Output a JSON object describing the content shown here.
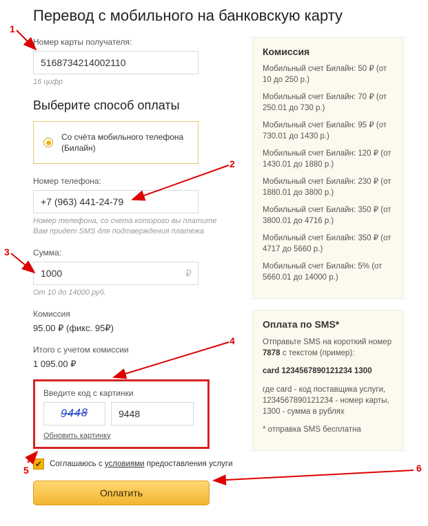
{
  "title": "Перевод с мобильного на банковскую карту",
  "card": {
    "label": "Номер карты получателя:",
    "value": "5168734214002110",
    "hint": "16 цифр"
  },
  "method_heading": "Выберите способ оплаты",
  "method_radio": "Со счёта мобильного телефона (Билайн)",
  "phone": {
    "label": "Номер телефона:",
    "value": "+7 (963) 441-24-79",
    "hint": "Номер телефона, со счета которого вы платите\nВам придет SMS для подтверждения платежа"
  },
  "amount": {
    "label": "Сумма:",
    "value": "1000",
    "suffix": "₽",
    "hint": "От 10 до 14000 руб."
  },
  "fee": {
    "label": "Комиссия",
    "value": "95.00 ₽ (фикс. 95₽)"
  },
  "total": {
    "label": "Итого с учетом комиссии",
    "value": "1 095.00 ₽"
  },
  "captcha": {
    "label": "Введите код с картинки",
    "image_text": "9448",
    "value": "9448",
    "refresh": "Обновить картинку"
  },
  "agree": {
    "pre": "Соглашаюсь с ",
    "link": "условиями",
    "post": " предоставления услуги"
  },
  "pay_button": "Оплатить",
  "commission_box": {
    "title": "Комиссия",
    "items": [
      "Мобильный счет Билайн: 50 ₽ (от 10 до 250 р.)",
      "Мобильный счет Билайн: 70 ₽ (от 250.01 до 730 р.)",
      "Мобильный счет Билайн: 95 ₽ (от 730.01 до 1430 р.)",
      "Мобильный счет Билайн: 120 ₽ (от 1430.01 до 1880 р.)",
      "Мобильный счет Билайн: 230 ₽ (от 1880.01 до 3800 р.)",
      "Мобильный счет Билайн: 350 ₽ (от 3800.01 до 4716 р.)",
      "Мобильный счет Билайн: 350 ₽ (от 4717 до 5660 р.)",
      "Мобильный счет Билайн: 5% (от 5660.01 до 14000 р.)"
    ]
  },
  "sms_box": {
    "title": "Оплата по SMS*",
    "line1_pre": "Отправьте SMS на короткий номер ",
    "line1_num": "7878",
    "line1_post": " с текстом (пример):",
    "example": "card 1234567890121234 1300",
    "desc": "где card - код поставщика услуги, 1234567890121234 - номер карты, 1300 - сумма в рублях",
    "note": "* отправка SMS бесплатна"
  },
  "annotations": [
    "1",
    "2",
    "3",
    "4",
    "5",
    "6"
  ]
}
